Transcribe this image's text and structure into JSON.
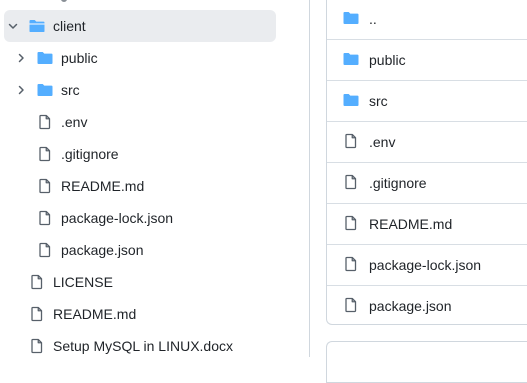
{
  "tree": {
    "client": {
      "label": "client"
    },
    "children": [
      {
        "label": "public",
        "type": "folder"
      },
      {
        "label": "src",
        "type": "folder"
      },
      {
        "label": ".env",
        "type": "file"
      },
      {
        "label": ".gitignore",
        "type": "file"
      },
      {
        "label": "README.md",
        "type": "file"
      },
      {
        "label": "package-lock.json",
        "type": "file"
      },
      {
        "label": "package.json",
        "type": "file"
      }
    ],
    "root_files": [
      {
        "label": "LICENSE"
      },
      {
        "label": "README.md"
      },
      {
        "label": "Setup MySQL in LINUX.docx"
      }
    ]
  },
  "listing": {
    "rows": [
      {
        "label": "..",
        "type": "folder"
      },
      {
        "label": "public",
        "type": "folder"
      },
      {
        "label": "src",
        "type": "folder"
      },
      {
        "label": ".env",
        "type": "file"
      },
      {
        "label": ".gitignore",
        "type": "file"
      },
      {
        "label": "README.md",
        "type": "file"
      },
      {
        "label": "package-lock.json",
        "type": "file"
      },
      {
        "label": "package.json",
        "type": "file"
      }
    ]
  },
  "colors": {
    "folder": "#54aeff",
    "file_icon": "#57606a",
    "selected_bg": "#eaecef",
    "border": "#d0d7de"
  }
}
